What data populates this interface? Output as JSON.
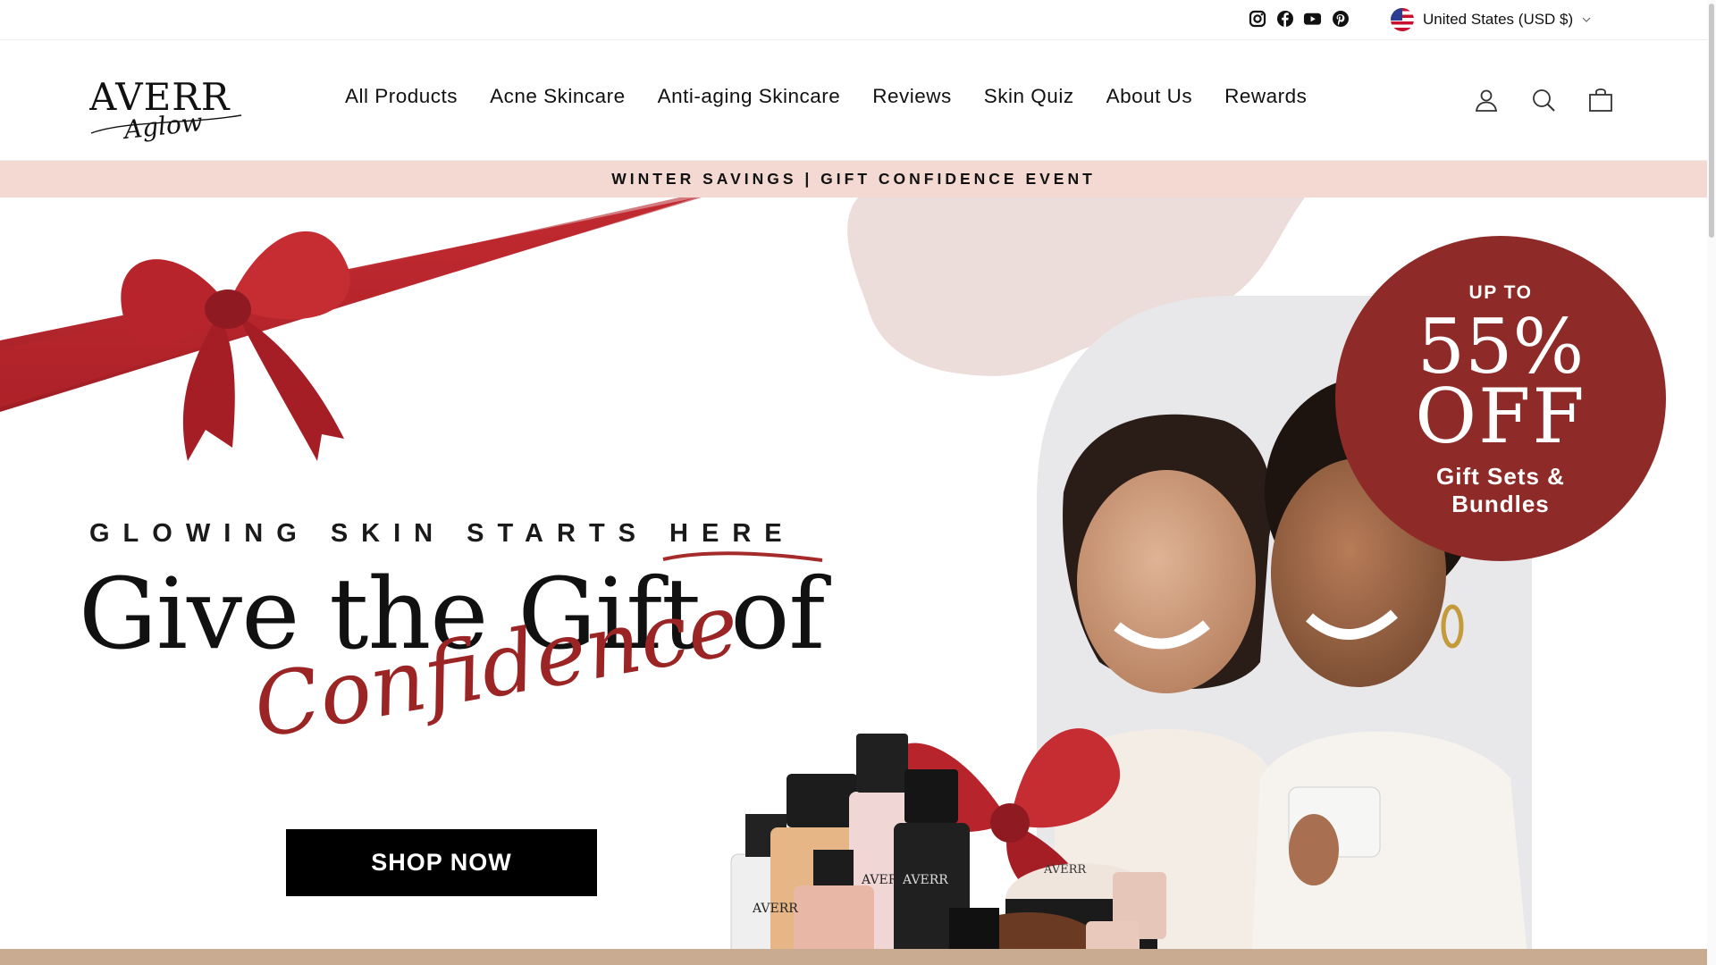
{
  "utility": {
    "social": [
      "instagram-icon",
      "facebook-icon",
      "youtube-icon",
      "pinterest-icon"
    ],
    "country_label": "United States (USD $)"
  },
  "brand": {
    "name_top": "AVERR",
    "name_script": "Aglow"
  },
  "nav": {
    "items": [
      "All Products",
      "Acne Skincare",
      "Anti-aging Skincare",
      "Reviews",
      "Skin Quiz",
      "About Us",
      "Rewards"
    ]
  },
  "header_icons": [
    "account-icon",
    "search-icon",
    "cart-icon"
  ],
  "announcement": {
    "text": "WINTER SAVINGS | GIFT CONFIDENCE EVENT"
  },
  "hero": {
    "tagline": "GLOWING SKIN STARTS HERE",
    "headline": "Give the Gift of",
    "script": "Confidence",
    "cta": "SHOP NOW",
    "badge": {
      "upto": "UP TO",
      "percent": "55%",
      "off": "OFF",
      "subtitle_line1": "Gift Sets &",
      "subtitle_line2": "Bundles"
    }
  },
  "colors": {
    "announcement_bg": "#f4d9d3",
    "accent_red": "#8e2a27",
    "ribbon": "#b8242c",
    "strip": "#c9ab91"
  }
}
